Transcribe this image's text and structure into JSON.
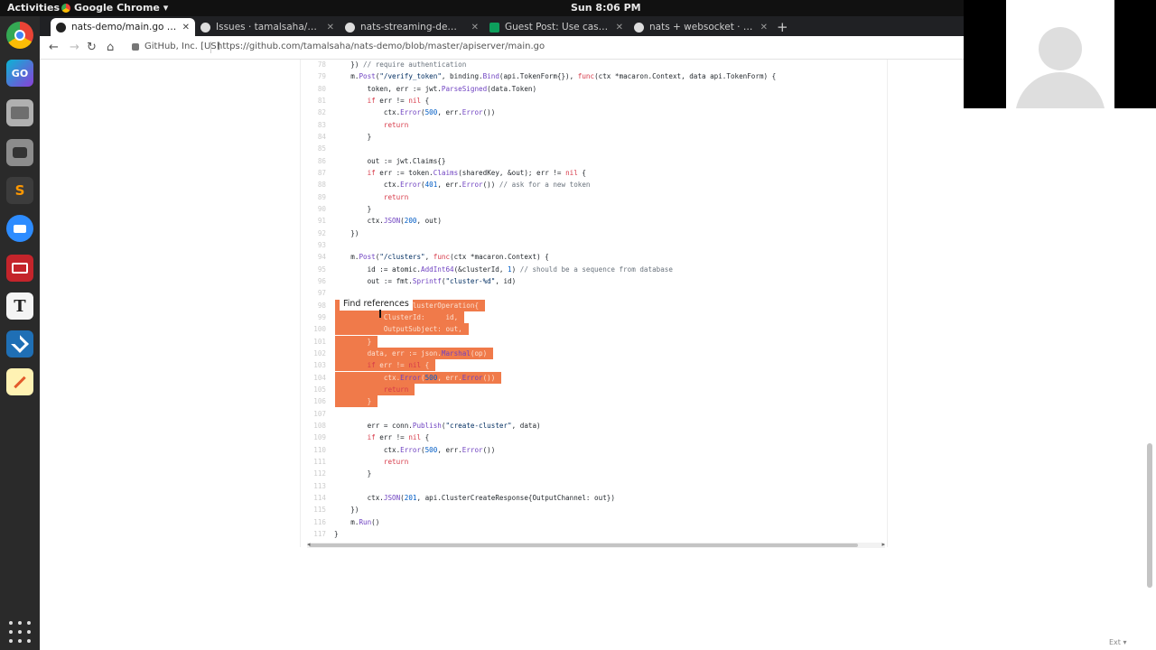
{
  "system": {
    "activities": "Activities",
    "app_name": "Google Chrome ▾",
    "clock": "Sun  8:06 PM"
  },
  "dock": {
    "icons": [
      "chrome-icon",
      "goland-icon",
      "files-icon",
      "screenshot-icon",
      "sublime-icon",
      "zoom-icon",
      "terminal-icon",
      "typora-icon",
      "vscode-icon",
      "notes-icon",
      "apps-grid-icon"
    ]
  },
  "browser": {
    "tabs": [
      {
        "title": "nats-demo/main.go at m"
      },
      {
        "title": "Issues · tamalsaha/kube-"
      },
      {
        "title": "nats-streaming-demos · I"
      },
      {
        "title": "Guest Post: Use cases for"
      },
      {
        "title": "nats + websocket · Issue #"
      }
    ],
    "new_tab": "+",
    "site_identity": "GitHub, Inc. [US]",
    "url": "https://github.com/tamalsaha/nats-demo/blob/master/apiserver/main.go"
  },
  "code": {
    "lines": [
      {
        "num": "78",
        "text": "    }) // require authentication",
        "selected": false
      },
      {
        "num": "79",
        "text": "    m.Post(\"/verify_token\", binding.Bind(api.TokenForm{}), func(ctx *macaron.Context, data api.TokenForm) {",
        "selected": false
      },
      {
        "num": "80",
        "text": "        token, err := jwt.ParseSigned(data.Token)",
        "selected": false
      },
      {
        "num": "81",
        "text": "        if err != nil {",
        "selected": false
      },
      {
        "num": "82",
        "text": "            ctx.Error(500, err.Error())",
        "selected": false
      },
      {
        "num": "83",
        "text": "            return",
        "selected": false
      },
      {
        "num": "84",
        "text": "        }",
        "selected": false
      },
      {
        "num": "85",
        "text": "",
        "selected": false
      },
      {
        "num": "86",
        "text": "        out := jwt.Claims{}",
        "selected": false
      },
      {
        "num": "87",
        "text": "        if err := token.Claims(sharedKey, &out); err != nil {",
        "selected": false
      },
      {
        "num": "88",
        "text": "            ctx.Error(401, err.Error()) // ask for a new token",
        "selected": false
      },
      {
        "num": "89",
        "text": "            return",
        "selected": false
      },
      {
        "num": "90",
        "text": "        }",
        "selected": false
      },
      {
        "num": "91",
        "text": "        ctx.JSON(200, out)",
        "selected": false
      },
      {
        "num": "92",
        "text": "    })",
        "selected": false
      },
      {
        "num": "93",
        "text": "",
        "selected": false
      },
      {
        "num": "94",
        "text": "    m.Post(\"/clusters\", func(ctx *macaron.Context) {",
        "selected": false
      },
      {
        "num": "95",
        "text": "        id := atomic.AddInt64(&clusterId, 1) // should be a sequence from database",
        "selected": false
      },
      {
        "num": "96",
        "text": "        out := fmt.Sprintf(\"cluster-%d\", id)",
        "selected": false
      },
      {
        "num": "97",
        "text": "",
        "selected": false
      },
      {
        "num": "98",
        "text": "        op := api.ClusterOperation{",
        "selected": true
      },
      {
        "num": "99",
        "text": "            ClusterId:     id,",
        "selected": true
      },
      {
        "num": "100",
        "text": "            OutputSubject: out,",
        "selected": true
      },
      {
        "num": "101",
        "text": "        }",
        "selected": true
      },
      {
        "num": "102",
        "text": "        data, err := json.Marshal(op)",
        "selected": true
      },
      {
        "num": "103",
        "text": "        if err != nil {",
        "selected": true
      },
      {
        "num": "104",
        "text": "            ctx.Error(500, err.Error())",
        "selected": true
      },
      {
        "num": "105",
        "text": "            return",
        "selected": true
      },
      {
        "num": "106",
        "text": "        }",
        "selected": true
      },
      {
        "num": "107",
        "text": "",
        "selected": false
      },
      {
        "num": "108",
        "text": "        err = conn.Publish(\"create-cluster\", data)",
        "selected": false
      },
      {
        "num": "109",
        "text": "        if err != nil {",
        "selected": false
      },
      {
        "num": "110",
        "text": "            ctx.Error(500, err.Error())",
        "selected": false
      },
      {
        "num": "111",
        "text": "            return",
        "selected": false
      },
      {
        "num": "112",
        "text": "        }",
        "selected": false
      },
      {
        "num": "113",
        "text": "",
        "selected": false
      },
      {
        "num": "114",
        "text": "        ctx.JSON(201, api.ClusterCreateResponse{OutputChannel: out})",
        "selected": false
      },
      {
        "num": "115",
        "text": "    })",
        "selected": false
      },
      {
        "num": "116",
        "text": "    m.Run()",
        "selected": false
      },
      {
        "num": "117",
        "text": "}",
        "selected": false
      }
    ]
  },
  "tooltip": {
    "label": "Find references"
  },
  "footer": {
    "ext_label": "Ext ▾"
  },
  "colors": {
    "selection": "#f07a4a",
    "keyword": "#d73a49",
    "function": "#6f42c1",
    "string": "#032f62",
    "number": "#005cc5",
    "comment": "#6a737d"
  }
}
